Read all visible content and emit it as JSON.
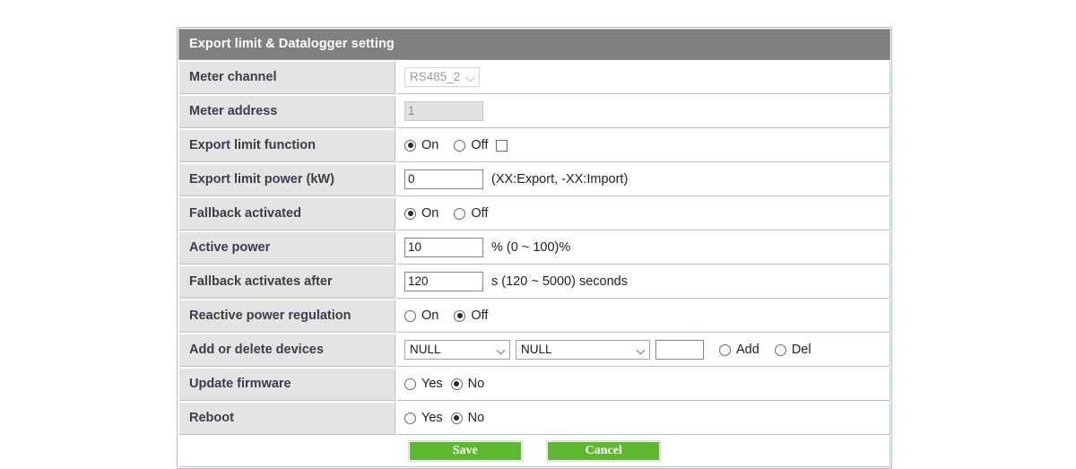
{
  "panel": {
    "title": "Export limit & Datalogger setting"
  },
  "rows": [
    {
      "id": "meter-channel",
      "label": "Meter channel",
      "control": "select-disabled",
      "value": "RS485_2"
    },
    {
      "id": "meter-address",
      "label": "Meter address",
      "control": "text-disabled",
      "value": "1"
    },
    {
      "id": "export-limit-function",
      "label": "Export limit function",
      "control": "radio-on-off-check",
      "on_label": "On",
      "off_label": "Off",
      "selected": "On",
      "checkbox_checked": false
    },
    {
      "id": "export-limit-power",
      "label": "Export limit power (kW)",
      "control": "text-hint",
      "value": "0",
      "hint": "(XX:Export, -XX:Import)"
    },
    {
      "id": "fallback-activated",
      "label": "Fallback activated",
      "control": "radio-on-off",
      "on_label": "On",
      "off_label": "Off",
      "selected": "On"
    },
    {
      "id": "active-power",
      "label": "Active power",
      "control": "text-hint",
      "value": "10",
      "hint": "% (0 ~ 100)%"
    },
    {
      "id": "fallback-activates-after",
      "label": "Fallback activates after",
      "control": "text-hint",
      "value": "120",
      "hint": "s (120 ~ 5000) seconds"
    },
    {
      "id": "reactive-power-regulation",
      "label": "Reactive power regulation",
      "control": "radio-on-off",
      "on_label": "On",
      "off_label": "Off",
      "selected": "Off"
    },
    {
      "id": "add-or-delete-devices",
      "label": "Add or delete devices",
      "control": "device-row",
      "select1_value": "NULL",
      "select2_value": "NULL",
      "text_value": "",
      "add_label": "Add",
      "del_label": "Del",
      "selected": ""
    },
    {
      "id": "update-firmware",
      "label": "Update firmware",
      "control": "radio-yes-no",
      "yes_label": "Yes",
      "no_label": "No",
      "selected": "No"
    },
    {
      "id": "reboot",
      "label": "Reboot",
      "control": "radio-yes-no",
      "yes_label": "Yes",
      "no_label": "No",
      "selected": "No"
    }
  ],
  "footer": {
    "save_label": "Save",
    "cancel_label": "Cancel",
    "button_color": "#5db82e"
  }
}
